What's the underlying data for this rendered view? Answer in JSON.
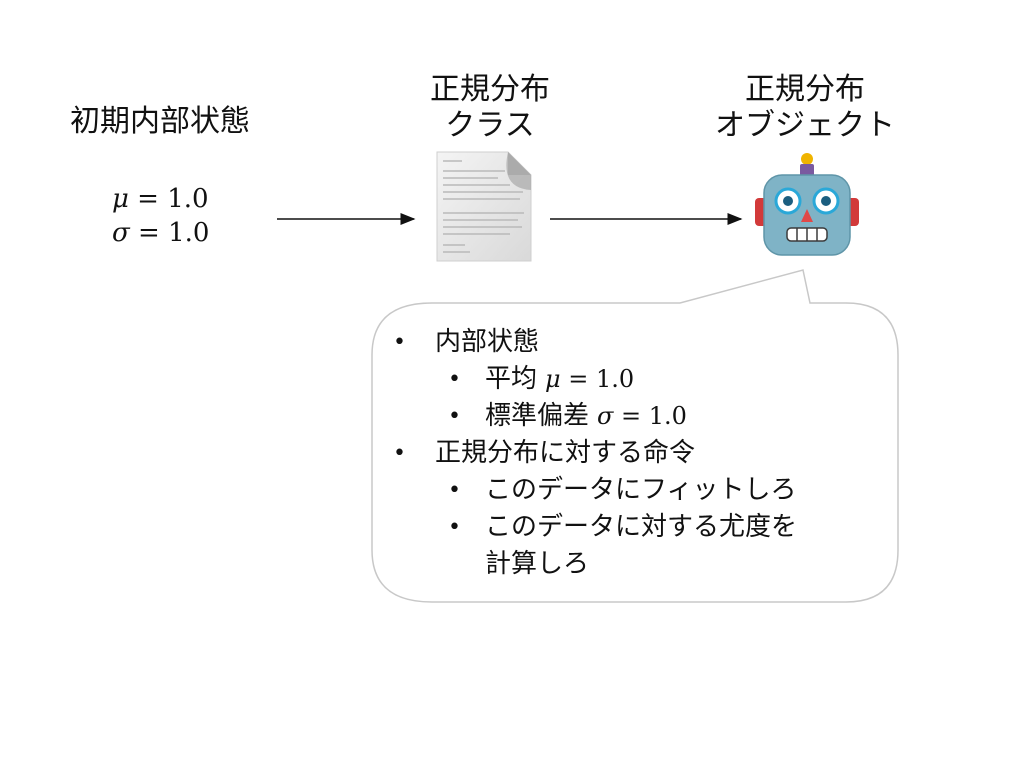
{
  "initial_state": {
    "title": "初期内部状態",
    "params": [
      {
        "symbol": "μ",
        "eq": " = 1.0"
      },
      {
        "symbol": "σ",
        "eq": " = 1.0"
      }
    ]
  },
  "class_node": {
    "title_line1": "正規分布",
    "title_line2": "クラス",
    "icon": "document-icon"
  },
  "object_node": {
    "title_line1": "正規分布",
    "title_line2": "オブジェクト",
    "icon": "robot-icon"
  },
  "bubble": {
    "items": [
      {
        "text": "内部状態"
      },
      {
        "text": "平均",
        "symbol": "μ",
        "eq": " = 1.0"
      },
      {
        "text": "標準偏差",
        "symbol": "σ",
        "eq": " = 1.0"
      },
      {
        "text": "正規分布に対する命令"
      },
      {
        "text": "このデータにフィットしろ"
      },
      {
        "text": "このデータに対する尤度を"
      },
      {
        "text": "計算しろ"
      }
    ],
    "bullet": "•"
  },
  "colors": {
    "text": "#111111",
    "robot_face": "#7fb3c6",
    "robot_ears": "#d23a3a",
    "robot_antenna": "#f0b400",
    "bubble_border": "#c8c8c8"
  }
}
